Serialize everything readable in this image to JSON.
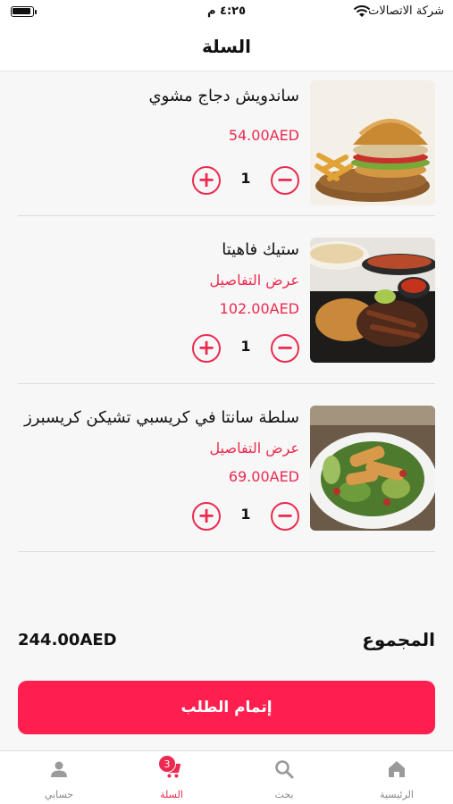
{
  "status_bar": {
    "time": "٤:٢٥ م",
    "carrier": "شركة الاتصالات"
  },
  "header": {
    "title": "السلة"
  },
  "cart": {
    "items": [
      {
        "name": "ساندويش دجاج مشوي",
        "details_link": "",
        "price": "54.00AED",
        "quantity": "1",
        "image": "grilled-chicken-sandwich-photo"
      },
      {
        "name": "ستيك فاهيتا",
        "details_link": "عرض التفاصيل",
        "price": "102.00AED",
        "quantity": "1",
        "image": "steak-fajita-photo"
      },
      {
        "name": "سلطة سانتا في كريسبي تشيكن كريسبرز",
        "details_link": "عرض التفاصيل",
        "price": "69.00AED",
        "quantity": "1",
        "image": "crispy-chicken-salad-photo"
      }
    ],
    "minus_symbol": "−",
    "plus_symbol": "+"
  },
  "summary": {
    "total_label": "المجموع",
    "total_value": "244.00AED"
  },
  "checkout": {
    "label": "إتمام الطلب"
  },
  "tabbar": {
    "home": "الرئيسية",
    "search": "بحث",
    "cart": "السلة",
    "cart_badge": "3",
    "account": "حسابي"
  },
  "colors": {
    "accent": "#ec2a4f",
    "checkout_bg": "#ff1f4f",
    "icon_gray": "#9a9a9a"
  }
}
